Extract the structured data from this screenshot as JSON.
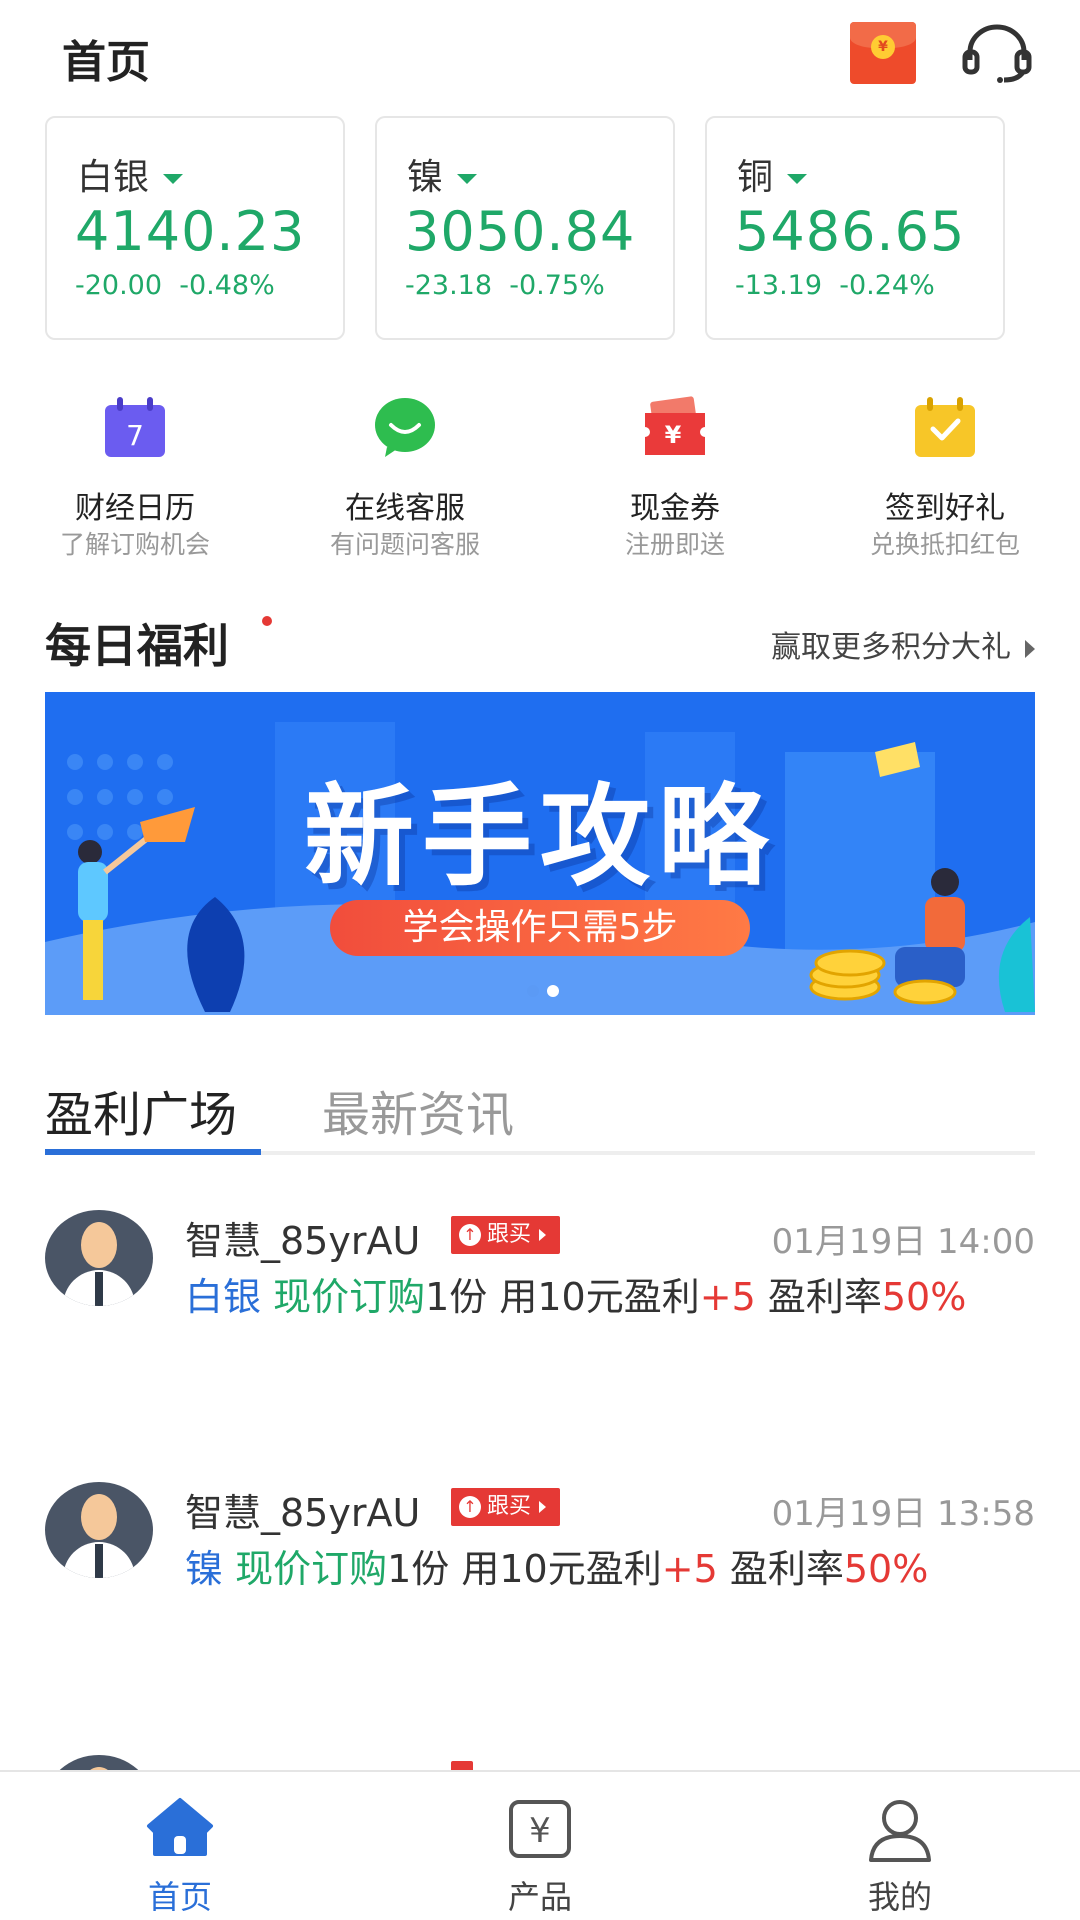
{
  "header": {
    "title": "首页"
  },
  "prices": [
    {
      "name": "白银",
      "price": "4140.23",
      "change": "-20.00",
      "pct": "-0.48%"
    },
    {
      "name": "镍",
      "price": "3050.84",
      "change": "-23.18",
      "pct": "-0.75%"
    },
    {
      "name": "铜",
      "price": "5486.65",
      "change": "-13.19",
      "pct": "-0.24%"
    }
  ],
  "shortcuts": [
    {
      "label": "财经日历",
      "sub": "了解订购机会",
      "icon": "calendar-icon",
      "icon_text": "7"
    },
    {
      "label": "在线客服",
      "sub": "有问题问客服",
      "icon": "chat-bubble-icon"
    },
    {
      "label": "现金券",
      "sub": "注册即送",
      "icon": "coupon-icon",
      "icon_text": "¥"
    },
    {
      "label": "签到好礼",
      "sub": "兑换抵扣红包",
      "icon": "checkin-icon"
    }
  ],
  "daily": {
    "title": "每日福利",
    "more": "赢取更多积分大礼"
  },
  "banner": {
    "headline": "新手攻略",
    "pill": "学会操作只需5步"
  },
  "tabs": [
    {
      "label": "盈利广场"
    },
    {
      "label": "最新资讯"
    }
  ],
  "feed": [
    {
      "user": "智慧_85yrAU",
      "badge": "跟买",
      "time": "01月19日 14:00",
      "metal": "白银",
      "action": "现价订购",
      "middle": "1份 用10元盈利",
      "profit": "+5",
      "rate_label": " 盈利率",
      "rate": "50%"
    },
    {
      "user": "智慧_85yrAU",
      "badge": "跟买",
      "time": "01月19日 13:58",
      "metal": "镍",
      "action": "现价订购",
      "middle": "1份 用10元盈利",
      "profit": "+5",
      "rate_label": " 盈利率",
      "rate": "50%"
    }
  ],
  "nav": [
    {
      "label": "首页"
    },
    {
      "label": "产品"
    },
    {
      "label": "我的"
    }
  ],
  "colors": {
    "accent": "#2a6fd8",
    "rise_fall_green": "#1fa868",
    "red": "#e53935"
  }
}
